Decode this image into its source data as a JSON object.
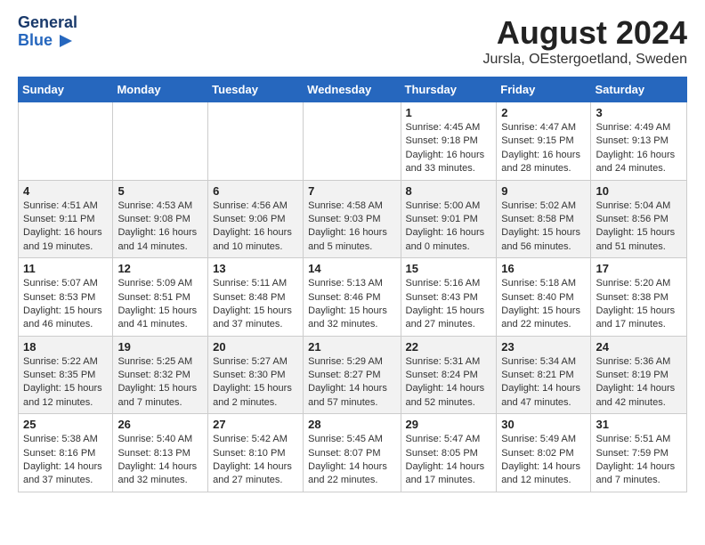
{
  "header": {
    "logo_line1": "General",
    "logo_line2": "Blue",
    "title": "August 2024",
    "subtitle": "Jursla, OEstergoetland, Sweden"
  },
  "weekdays": [
    "Sunday",
    "Monday",
    "Tuesday",
    "Wednesday",
    "Thursday",
    "Friday",
    "Saturday"
  ],
  "weeks": [
    [
      {
        "day": "",
        "info": ""
      },
      {
        "day": "",
        "info": ""
      },
      {
        "day": "",
        "info": ""
      },
      {
        "day": "",
        "info": ""
      },
      {
        "day": "1",
        "info": "Sunrise: 4:45 AM\nSunset: 9:18 PM\nDaylight: 16 hours\nand 33 minutes."
      },
      {
        "day": "2",
        "info": "Sunrise: 4:47 AM\nSunset: 9:15 PM\nDaylight: 16 hours\nand 28 minutes."
      },
      {
        "day": "3",
        "info": "Sunrise: 4:49 AM\nSunset: 9:13 PM\nDaylight: 16 hours\nand 24 minutes."
      }
    ],
    [
      {
        "day": "4",
        "info": "Sunrise: 4:51 AM\nSunset: 9:11 PM\nDaylight: 16 hours\nand 19 minutes."
      },
      {
        "day": "5",
        "info": "Sunrise: 4:53 AM\nSunset: 9:08 PM\nDaylight: 16 hours\nand 14 minutes."
      },
      {
        "day": "6",
        "info": "Sunrise: 4:56 AM\nSunset: 9:06 PM\nDaylight: 16 hours\nand 10 minutes."
      },
      {
        "day": "7",
        "info": "Sunrise: 4:58 AM\nSunset: 9:03 PM\nDaylight: 16 hours\nand 5 minutes."
      },
      {
        "day": "8",
        "info": "Sunrise: 5:00 AM\nSunset: 9:01 PM\nDaylight: 16 hours\nand 0 minutes."
      },
      {
        "day": "9",
        "info": "Sunrise: 5:02 AM\nSunset: 8:58 PM\nDaylight: 15 hours\nand 56 minutes."
      },
      {
        "day": "10",
        "info": "Sunrise: 5:04 AM\nSunset: 8:56 PM\nDaylight: 15 hours\nand 51 minutes."
      }
    ],
    [
      {
        "day": "11",
        "info": "Sunrise: 5:07 AM\nSunset: 8:53 PM\nDaylight: 15 hours\nand 46 minutes."
      },
      {
        "day": "12",
        "info": "Sunrise: 5:09 AM\nSunset: 8:51 PM\nDaylight: 15 hours\nand 41 minutes."
      },
      {
        "day": "13",
        "info": "Sunrise: 5:11 AM\nSunset: 8:48 PM\nDaylight: 15 hours\nand 37 minutes."
      },
      {
        "day": "14",
        "info": "Sunrise: 5:13 AM\nSunset: 8:46 PM\nDaylight: 15 hours\nand 32 minutes."
      },
      {
        "day": "15",
        "info": "Sunrise: 5:16 AM\nSunset: 8:43 PM\nDaylight: 15 hours\nand 27 minutes."
      },
      {
        "day": "16",
        "info": "Sunrise: 5:18 AM\nSunset: 8:40 PM\nDaylight: 15 hours\nand 22 minutes."
      },
      {
        "day": "17",
        "info": "Sunrise: 5:20 AM\nSunset: 8:38 PM\nDaylight: 15 hours\nand 17 minutes."
      }
    ],
    [
      {
        "day": "18",
        "info": "Sunrise: 5:22 AM\nSunset: 8:35 PM\nDaylight: 15 hours\nand 12 minutes."
      },
      {
        "day": "19",
        "info": "Sunrise: 5:25 AM\nSunset: 8:32 PM\nDaylight: 15 hours\nand 7 minutes."
      },
      {
        "day": "20",
        "info": "Sunrise: 5:27 AM\nSunset: 8:30 PM\nDaylight: 15 hours\nand 2 minutes."
      },
      {
        "day": "21",
        "info": "Sunrise: 5:29 AM\nSunset: 8:27 PM\nDaylight: 14 hours\nand 57 minutes."
      },
      {
        "day": "22",
        "info": "Sunrise: 5:31 AM\nSunset: 8:24 PM\nDaylight: 14 hours\nand 52 minutes."
      },
      {
        "day": "23",
        "info": "Sunrise: 5:34 AM\nSunset: 8:21 PM\nDaylight: 14 hours\nand 47 minutes."
      },
      {
        "day": "24",
        "info": "Sunrise: 5:36 AM\nSunset: 8:19 PM\nDaylight: 14 hours\nand 42 minutes."
      }
    ],
    [
      {
        "day": "25",
        "info": "Sunrise: 5:38 AM\nSunset: 8:16 PM\nDaylight: 14 hours\nand 37 minutes."
      },
      {
        "day": "26",
        "info": "Sunrise: 5:40 AM\nSunset: 8:13 PM\nDaylight: 14 hours\nand 32 minutes."
      },
      {
        "day": "27",
        "info": "Sunrise: 5:42 AM\nSunset: 8:10 PM\nDaylight: 14 hours\nand 27 minutes."
      },
      {
        "day": "28",
        "info": "Sunrise: 5:45 AM\nSunset: 8:07 PM\nDaylight: 14 hours\nand 22 minutes."
      },
      {
        "day": "29",
        "info": "Sunrise: 5:47 AM\nSunset: 8:05 PM\nDaylight: 14 hours\nand 17 minutes."
      },
      {
        "day": "30",
        "info": "Sunrise: 5:49 AM\nSunset: 8:02 PM\nDaylight: 14 hours\nand 12 minutes."
      },
      {
        "day": "31",
        "info": "Sunrise: 5:51 AM\nSunset: 7:59 PM\nDaylight: 14 hours\nand 7 minutes."
      }
    ]
  ]
}
